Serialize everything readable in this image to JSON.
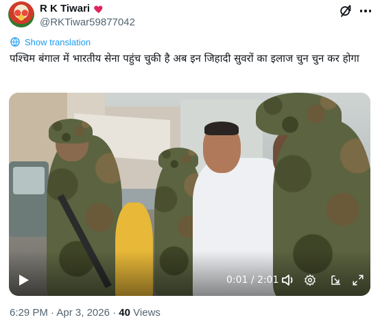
{
  "author": {
    "display_name": "R K Tiwari",
    "handle": "@RKTiwar59877042",
    "avatar_icon": "flowers-avatar",
    "badge_icon": "red-heart-icon"
  },
  "header_actions": {
    "grok_icon": "grok-icon",
    "more_icon": "more-dots-icon"
  },
  "translate": {
    "icon": "globe-icon",
    "label": "Show translation"
  },
  "tweet": {
    "text": "पश्चिम बंगाल में भारतीय सेना पहुंच चुकी है अब इन जिहादी सुवरों का इलाज चुन चुन कर होगा"
  },
  "video": {
    "timecode": "0:01 / 2:01",
    "controls": [
      "play-icon",
      "volume-icon",
      "settings-gear-icon",
      "picture-in-picture-icon",
      "fullscreen-icon"
    ]
  },
  "meta": {
    "time": "6:29 PM",
    "separator": "·",
    "date": "Apr 3, 2026",
    "views_count": "40",
    "views_label": "Views"
  },
  "colors": {
    "link_blue": "#1d9bf0",
    "secondary_text": "#536471",
    "primary_text": "#0f1419",
    "badge_red": "#e0245e"
  }
}
